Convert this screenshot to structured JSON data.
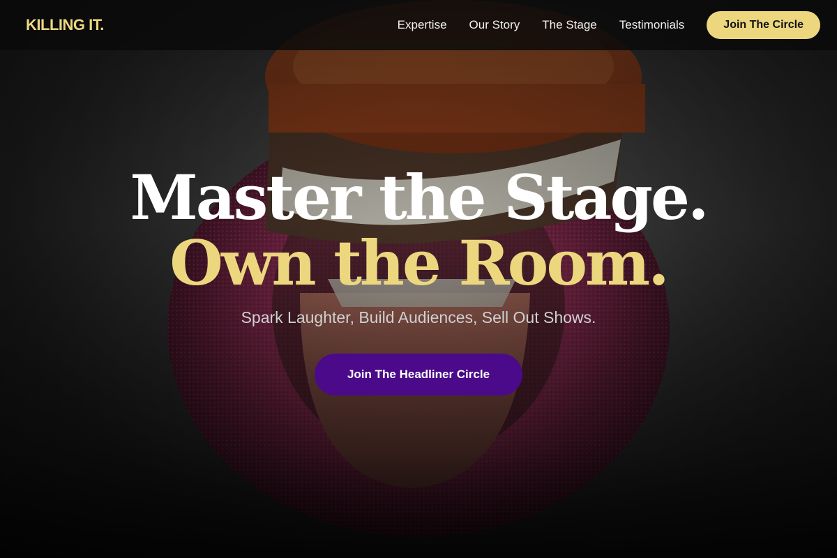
{
  "nav": {
    "logo": "KILLING IT.",
    "links": [
      {
        "label": "Expertise"
      },
      {
        "label": "Our Story"
      },
      {
        "label": "The Stage"
      },
      {
        "label": "Testimonials"
      }
    ],
    "cta_label": "Join The Circle"
  },
  "hero": {
    "headline_line1": "Master the Stage.",
    "headline_line2": "Own the Room.",
    "subheadline": "Spark Laughter, Build Audiences, Sell Out Shows.",
    "cta_label": "Join The Headliner Circle",
    "background_image": "wind-up-chattering-teeth-toy-on-red-fuzzy-ring"
  },
  "colors": {
    "accent_gold": "#ecd77f",
    "cta_purple": "#4a0a8a",
    "nav_background": "#0a0a0a"
  }
}
